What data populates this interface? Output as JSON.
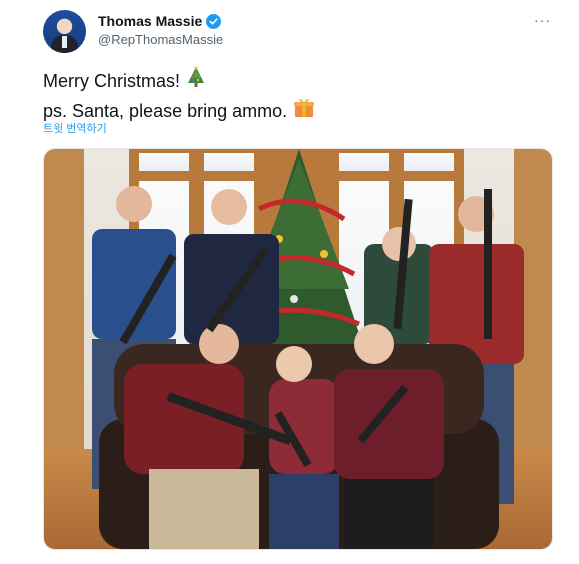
{
  "author": {
    "name": "Thomas Massie",
    "handle": "@RepThomasMassie",
    "verified": true,
    "avatar_icon": "avatar-icon"
  },
  "tweet": {
    "line1": "Merry Christmas!",
    "line1_emoji": "christmas-tree-icon",
    "line2": "ps. Santa, please bring ammo.",
    "line2_emoji": "gift-icon",
    "translate_label": "트윗 번역하기"
  },
  "menu": {
    "more_icon": "more-dots-icon",
    "more_label": "···"
  },
  "colors": {
    "accent": "#1d9bf0",
    "text_primary": "#0f1419",
    "text_secondary": "#536471"
  }
}
